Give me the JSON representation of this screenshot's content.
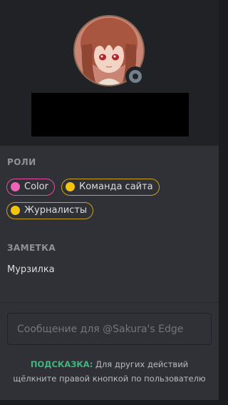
{
  "profile": {
    "avatar_icon": "anime-character-avatar-icon",
    "status": "offline",
    "status_color": "#747f8d"
  },
  "roles": {
    "title": "РОЛИ",
    "items": [
      {
        "label": "Color",
        "color": "#ef63b3"
      },
      {
        "label": "Команда сайта",
        "color": "#f3c40c"
      },
      {
        "label": "Журналисты",
        "color": "#f3c40c"
      }
    ]
  },
  "note": {
    "title": "ЗАМЕТКА",
    "text": "Мурзилка"
  },
  "message": {
    "placeholder": "Сообщение для @Sakura's Edge",
    "value": ""
  },
  "hint": {
    "label": "ПОДСКАЗКА:",
    "line1": "Для других действий",
    "line2": "щёлкните правой кнопкой по пользователю"
  }
}
